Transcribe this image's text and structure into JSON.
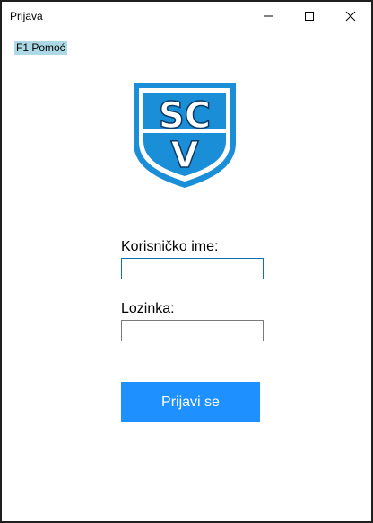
{
  "window": {
    "title": "Prijava"
  },
  "help": {
    "label": "F1 Pomoć"
  },
  "logo": {
    "text_top": "SC",
    "text_bottom": "V",
    "accent_color": "#1a8ed6"
  },
  "form": {
    "username_label": "Korisničko ime:",
    "username_value": "",
    "password_label": "Lozinka:",
    "password_value": "",
    "submit_label": "Prijavi se"
  },
  "colors": {
    "button": "#1e90ff",
    "help_background": "#add8e6"
  }
}
